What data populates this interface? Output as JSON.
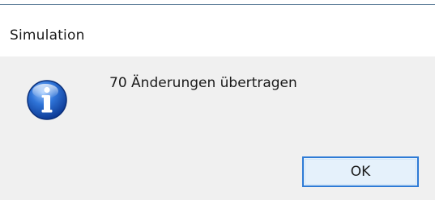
{
  "dialog": {
    "title": "Simulation",
    "message": "70 Änderungen übertragen",
    "icon": "info-icon",
    "ok_label": "OK"
  },
  "colors": {
    "content_background": "#f0f0f0",
    "title_background": "#ffffff",
    "button_border": "#2e7bd6",
    "button_background": "#e5f1fb",
    "icon_blue": "#1f5fc4"
  }
}
